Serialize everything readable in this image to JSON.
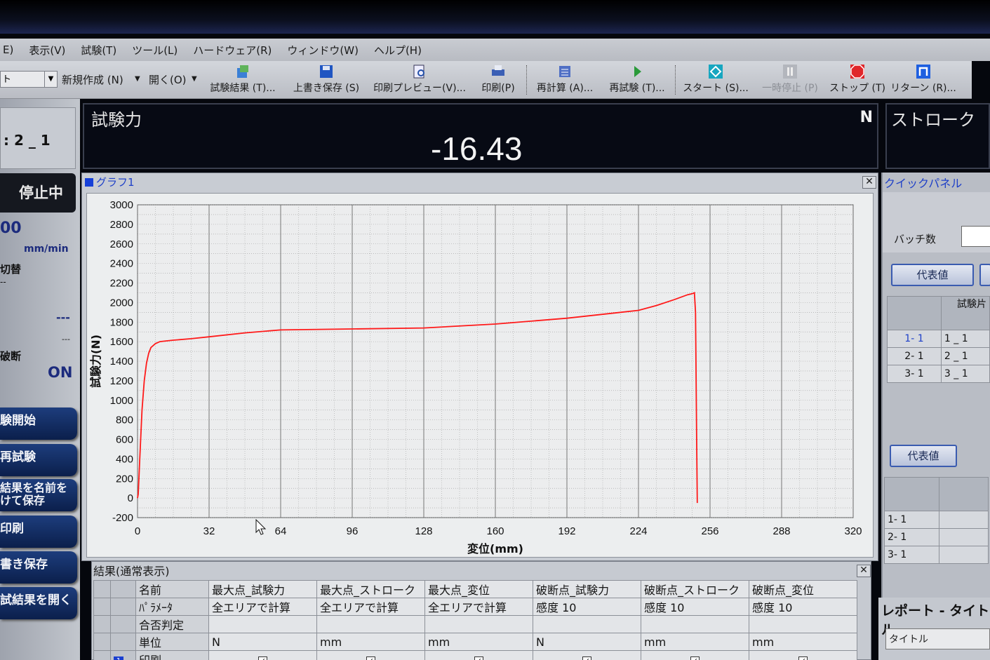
{
  "menu": [
    "E)",
    "表示(V)",
    "試験(T)",
    "ツール(L)",
    "ハードウェア(R)",
    "ウィンドウ(W)",
    "ヘルプ(H)"
  ],
  "toolbar": {
    "combo_text": "ト",
    "new_label": "新規作成 (N)",
    "open_label": "開く(O)",
    "buttons": [
      {
        "label": "試験結果 (T)...",
        "icon": "test-result-icon"
      },
      {
        "label": "上書き保存 (S)",
        "icon": "save-icon"
      },
      {
        "label": "印刷プレビュー(V)...",
        "icon": "print-preview-icon"
      },
      {
        "label": "印刷(P)",
        "icon": "print-icon"
      },
      {
        "label": "再計算 (A)...",
        "icon": "recalculate-icon"
      },
      {
        "label": "再試験 (T)...",
        "icon": "retest-icon"
      },
      {
        "label": "スタート (S)...",
        "icon": "start-icon"
      },
      {
        "label": "一時停止 (P)",
        "icon": "pause-icon"
      },
      {
        "label": "ストップ (T)",
        "icon": "stop-icon"
      },
      {
        "label": "リターン (R)...",
        "icon": "return-icon"
      }
    ]
  },
  "left": {
    "specimen_id": ": 2 _ 1",
    "status": "停止中",
    "speed_value": "00",
    "speed_unit": "mm/min",
    "switch_label": "切替",
    "switch_value": "--",
    "dash_big": "---",
    "dash_small": "---",
    "break_label": "破断",
    "break_value": "ON",
    "buttons": [
      "験開始",
      "再試験",
      "結果を名前を\nけて保存",
      "印刷",
      "書き保存",
      "試結果を開く"
    ]
  },
  "force": {
    "label": "試験力",
    "value": "-16.43",
    "unit": "N"
  },
  "stroke": {
    "label": "ストローク"
  },
  "graph": {
    "title": "グラフ1"
  },
  "chart_data": {
    "type": "line",
    "xlabel": "変位(mm)",
    "ylabel": "試験力(N)",
    "xlim": [
      0,
      320
    ],
    "ylim": [
      -200,
      3000
    ],
    "xticks": [
      0,
      32,
      64,
      96,
      128,
      160,
      192,
      224,
      256,
      288,
      320
    ],
    "yticks": [
      3000,
      2800,
      2600,
      2400,
      2200,
      2000,
      1800,
      1600,
      1400,
      1200,
      1000,
      800,
      600,
      400,
      200,
      0,
      -200
    ],
    "grid": true,
    "series": [
      {
        "color": "#ff1a1a",
        "x": [
          0,
          0.3,
          1,
          2,
          3,
          4,
          5,
          6,
          8,
          10,
          12,
          16,
          24,
          32,
          48,
          64,
          96,
          128,
          160,
          192,
          216,
          224,
          232,
          240,
          246,
          248,
          249,
          249.5,
          250,
          250.3
        ],
        "y": [
          0,
          40,
          400,
          900,
          1200,
          1380,
          1480,
          1540,
          1580,
          1600,
          1605,
          1615,
          1630,
          1650,
          1690,
          1720,
          1730,
          1740,
          1780,
          1840,
          1900,
          1920,
          1970,
          2030,
          2080,
          2090,
          2100,
          1900,
          600,
          -50
        ]
      }
    ]
  },
  "results": {
    "title": "結果(通常表示)",
    "row_headers": [
      "名前",
      "ﾊﾟﾗﾒｰﾀ",
      "合否判定",
      "単位",
      "印刷"
    ],
    "columns": [
      {
        "name": "最大点_試験力",
        "param": "全エリアで計算",
        "judge": "",
        "unit": "N",
        "print": "✓"
      },
      {
        "name": "最大点_ストローク",
        "param": "全エリアで計算",
        "judge": "",
        "unit": "mm",
        "print": "✓"
      },
      {
        "name": "最大点_変位",
        "param": "全エリアで計算",
        "judge": "",
        "unit": "mm",
        "print": "✓"
      },
      {
        "name": "破断点_試験力",
        "param": "感度 10",
        "judge": "",
        "unit": "N",
        "print": "✓"
      },
      {
        "name": "破断点_ストローク",
        "param": "感度 10",
        "judge": "",
        "unit": "mm",
        "print": "✓"
      },
      {
        "name": "破断点_変位",
        "param": "感度 10",
        "judge": "",
        "unit": "mm",
        "print": "✓"
      }
    ]
  },
  "quick": {
    "title": "クイックパネル",
    "batch_label": "バッチ数",
    "rep_btn": "代表値",
    "rep_btn2": "代表値",
    "col_header": "試験片",
    "rows": [
      {
        "num": "1- 1",
        "name": "1 _ 1"
      },
      {
        "num": "2- 1",
        "name": "2 _ 1"
      },
      {
        "num": "3- 1",
        "name": "3 _ 1"
      }
    ],
    "rows2": [
      "1- 1",
      "2- 1",
      "3- 1"
    ],
    "report_title": "レポート - タイトル",
    "report_field": "タイトル"
  }
}
